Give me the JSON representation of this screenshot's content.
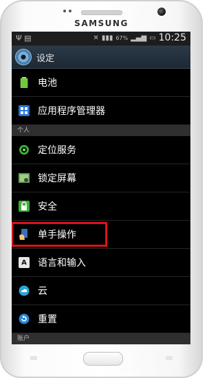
{
  "device": {
    "brand": "SAMSUNG"
  },
  "statusbar": {
    "battery": "67%",
    "time": "10:25"
  },
  "header": {
    "title": "设定"
  },
  "items_top": [
    {
      "label": "电池",
      "icon": "battery-icon"
    },
    {
      "label": "应用程序管理器",
      "icon": "apps-grid-icon"
    }
  ],
  "section_personal": "个人",
  "items_personal": [
    {
      "label": "定位服务",
      "icon": "location-icon"
    },
    {
      "label": "锁定屏幕",
      "icon": "lock-screen-icon"
    },
    {
      "label": "安全",
      "icon": "padlock-icon"
    },
    {
      "label": "单手操作",
      "icon": "one-hand-icon"
    },
    {
      "label": "语言和输入",
      "icon": "keyboard-a-icon"
    },
    {
      "label": "云",
      "icon": "cloud-icon"
    },
    {
      "label": "重置",
      "icon": "reset-icon"
    }
  ],
  "section_accounts": "账户",
  "colors": {
    "highlight": "#e0101a",
    "accent": "#4a7fae"
  }
}
